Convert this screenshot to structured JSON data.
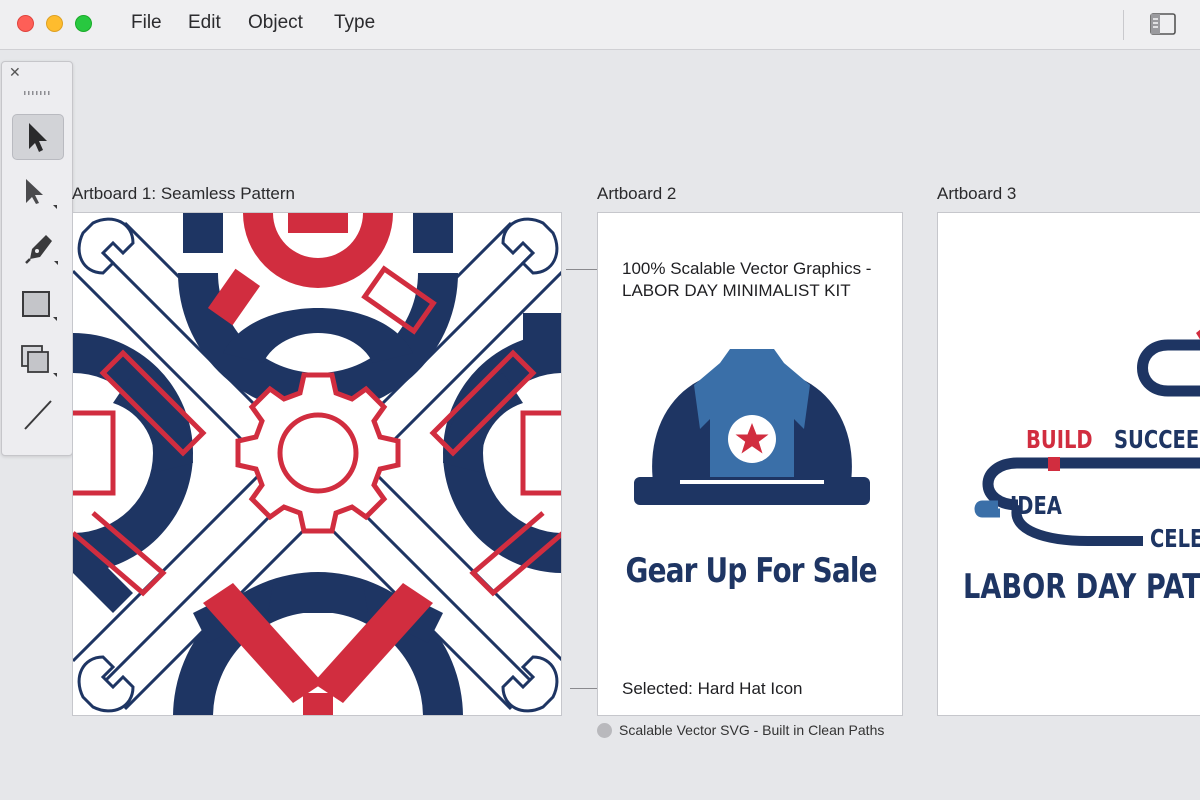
{
  "window": {
    "menu": [
      "File",
      "Edit",
      "Object",
      "Type"
    ]
  },
  "colors": {
    "navy": "#1e3563",
    "red": "#d12d3f",
    "blue": "#3a6fa8",
    "canvas": "#e6e7ea"
  },
  "tools": [
    {
      "name": "selection-tool",
      "icon": "arrow-icon",
      "active": true
    },
    {
      "name": "direct-selection-tool",
      "icon": "hollow-arrow-icon",
      "active": false
    },
    {
      "name": "pen-tool",
      "icon": "pen-nib-icon",
      "active": false
    },
    {
      "name": "rectangle-tool",
      "icon": "rectangle-icon",
      "active": false
    },
    {
      "name": "artboard-tool",
      "icon": "stacked-squares-icon",
      "active": false
    },
    {
      "name": "line-tool",
      "icon": "line-icon",
      "active": false
    }
  ],
  "artboards": [
    {
      "label": "Artboard 1: Seamless Pattern"
    },
    {
      "label": "Artboard 2",
      "callout_top": [
        "100% Scalable Vector Graphics -",
        "LABOR DAY MINIMALIST KIT"
      ],
      "callout_bottom": "Selected: Hard Hat Icon",
      "title": "Gear Up For Sale"
    },
    {
      "label": "Artboard 3",
      "words": {
        "build": "BUILD",
        "succeed": "SUCCEED",
        "idea": "IDEA",
        "celebrate": "CELEB",
        "title": "LABOR DAY PATHW"
      }
    }
  ],
  "footnote": "Scalable Vector SVG - Built in Clean Paths"
}
